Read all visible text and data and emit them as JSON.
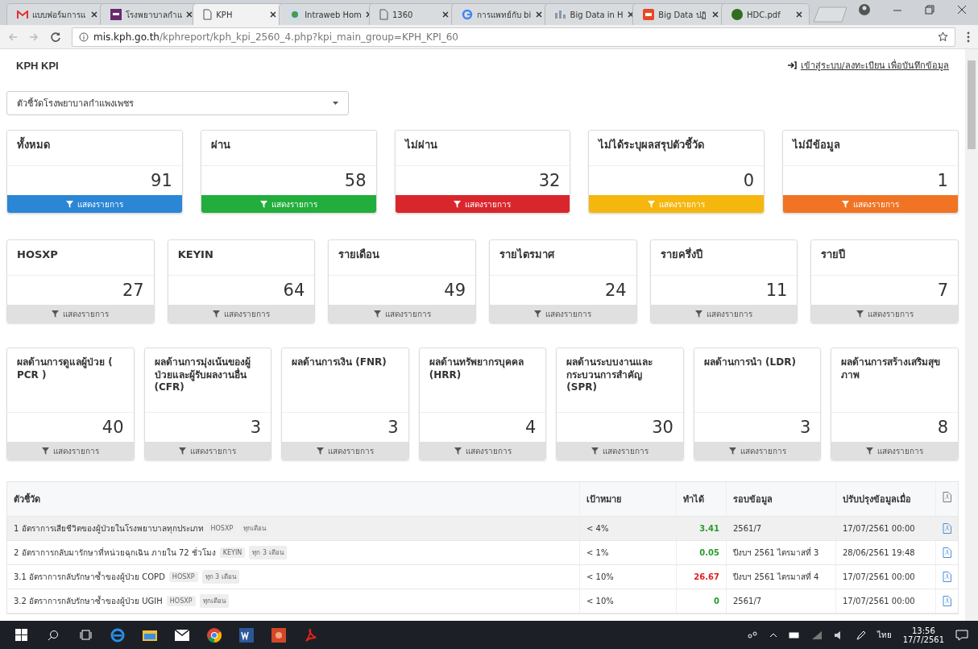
{
  "browser": {
    "tabs": [
      {
        "label": "แบบฟอร์มการแ",
        "selected": false
      },
      {
        "label": "โรงพยาบาลกำแ",
        "selected": false
      },
      {
        "label": "KPH",
        "selected": true
      },
      {
        "label": "Intraweb Hom",
        "selected": false
      },
      {
        "label": "1360",
        "selected": false
      },
      {
        "label": "การแพทย์กับ bi",
        "selected": false
      },
      {
        "label": "Big Data in H",
        "selected": false
      },
      {
        "label": "Big Data ปฏิ",
        "selected": false
      },
      {
        "label": "HDC.pdf",
        "selected": false
      }
    ],
    "url_host": "mis.kph.go.th",
    "url_path": "/kphreport/kph_kpi_2560_4.php?kpi_main_group=KPH_KPI_60"
  },
  "header": {
    "title": "KPH KPI",
    "login_link": "เข้าสู่ระบบ/ลงทะเบียน เพื่อบันทึกข้อมูล"
  },
  "group_select": {
    "value": "ตัวชี้วัดโรงพยาบาลกำแพงเพชร"
  },
  "card_groups": [
    {
      "cards": [
        {
          "title": "ทั้งหมด",
          "count": "91",
          "action": "แสดงรายการ",
          "color": "#2b86d6"
        },
        {
          "title": "ผ่าน",
          "count": "58",
          "action": "แสดงรายการ",
          "color": "#22ae3c"
        },
        {
          "title": "ไม่ผ่าน",
          "count": "32",
          "action": "แสดงรายการ",
          "color": "#d9262c"
        },
        {
          "title": "ไม่ได้ระบุผลสรุปตัวชี้วัด",
          "count": "0",
          "action": "แสดงรายการ",
          "color": "#f5b60e"
        },
        {
          "title": "ไม่มีข้อมูล",
          "count": "1",
          "action": "แสดงรายการ",
          "color": "#f07423"
        }
      ]
    },
    {
      "cards": [
        {
          "title": "HOSXP",
          "count": "27",
          "action": "แสดงรายการ"
        },
        {
          "title": "KEYIN",
          "count": "64",
          "action": "แสดงรายการ"
        },
        {
          "title": "รายเดือน",
          "count": "49",
          "action": "แสดงรายการ"
        },
        {
          "title": "รายไตรมาศ",
          "count": "24",
          "action": "แสดงรายการ"
        },
        {
          "title": "รายครึ่งปี",
          "count": "11",
          "action": "แสดงรายการ"
        },
        {
          "title": "รายปี",
          "count": "7",
          "action": "แสดงรายการ"
        }
      ]
    },
    {
      "cards": [
        {
          "title": "ผลด้านการดูแลผู้ป่วย ( PCR )",
          "count": "40",
          "action": "แสดงรายการ"
        },
        {
          "title": "ผลด้านการมุ่งเน้นของผู้ป่วยและผู้รับผลงานอื่น (CFR)",
          "count": "3",
          "action": "แสดงรายการ"
        },
        {
          "title": "ผลด้านการเงิน (FNR)",
          "count": "3",
          "action": "แสดงรายการ"
        },
        {
          "title": "ผลด้านทรัพยากรบุคคล (HRR)",
          "count": "4",
          "action": "แสดงรายการ"
        },
        {
          "title": "ผลด้านระบบงานและกระบวนการสำคัญ (SPR)",
          "count": "30",
          "action": "แสดงรายการ"
        },
        {
          "title": "ผลด้านการนำ (LDR)",
          "count": "3",
          "action": "แสดงรายการ"
        },
        {
          "title": "ผลด้านการสร้างเสริมสุขภาพ",
          "count": "8",
          "action": "แสดงรายการ"
        }
      ]
    }
  ],
  "table": {
    "columns": [
      "ตัวชี้วัด",
      "เป้าหมาย",
      "ทำได้",
      "รอบข้อมูล",
      "ปรับปรุงข้อมูลเมื่อ"
    ],
    "rows": [
      {
        "indicator": "1 อัตราการเสียชีวิตของผู้ป่วยในโรงพยาบาลทุกประเภท",
        "source": "HOSXP",
        "frequency": "ทุกเดือน",
        "target": "< 4%",
        "result": "3.41",
        "passed": true,
        "period": "2561/7",
        "updated": "17/07/2561 00:00",
        "selected": true
      },
      {
        "indicator": "2 อัตราการกลับมารักษาที่หน่วยฉุกเฉิน ภายใน 72 ชั่วโมง",
        "source": "KEYIN",
        "frequency": "ทุก 3 เดือน",
        "target": "< 1%",
        "result": "0.05",
        "passed": true,
        "period": "ปีงบฯ 2561 ไตรมาสที่ 3",
        "updated": "28/06/2561 19:48",
        "selected": false
      },
      {
        "indicator": "3.1 อัตราการกลับรักษาซ้ำของผู้ป่วย COPD",
        "source": "HOSXP",
        "frequency": "ทุก 3 เดือน",
        "target": "< 10%",
        "result": "26.67",
        "passed": false,
        "period": "ปีงบฯ 2561 ไตรมาสที่ 4",
        "updated": "17/07/2561 00:00",
        "selected": false
      },
      {
        "indicator": "3.2 อัตราการกลับรักษาซ้ำของผู้ป่วย UGIH",
        "source": "HOSXP",
        "frequency": "ทุกเดือน",
        "target": "< 10%",
        "result": "0",
        "passed": true,
        "period": "2561/7",
        "updated": "17/07/2561 00:00",
        "selected": false
      }
    ]
  },
  "taskbar": {
    "language": "ไทย",
    "time": "13:56",
    "date": "17/7/2561"
  }
}
